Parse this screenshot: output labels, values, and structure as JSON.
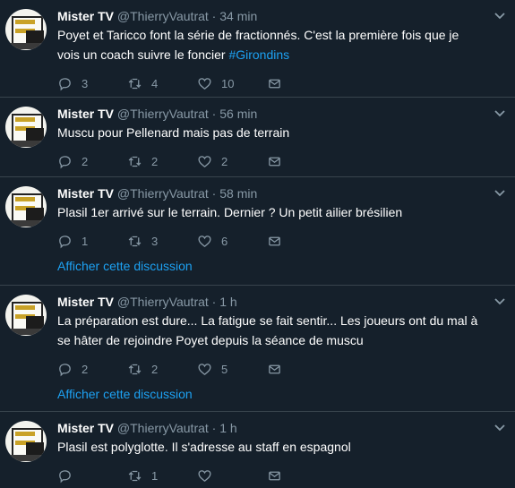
{
  "tweets": [
    {
      "name": "Mister TV",
      "handle": "@ThierryVautrat",
      "dot": "·",
      "time": "34 min",
      "text_before": "Poyet et Taricco font la série de fractionnés. C'est la première fois que je vois un coach suivre le  foncier ",
      "hashtag": "#Girondins",
      "replies": "3",
      "retweets": "4",
      "likes": "10",
      "thread_link": ""
    },
    {
      "name": "Mister TV",
      "handle": "@ThierryVautrat",
      "dot": "·",
      "time": "56 min",
      "text_before": "Muscu pour Pellenard mais pas de terrain",
      "hashtag": "",
      "replies": "2",
      "retweets": "2",
      "likes": "2",
      "thread_link": ""
    },
    {
      "name": "Mister TV",
      "handle": "@ThierryVautrat",
      "dot": "·",
      "time": "58 min",
      "text_before": "Plasil 1er arrivé sur le terrain. Dernier ? Un petit ailier brésilien",
      "hashtag": "",
      "replies": "1",
      "retweets": "3",
      "likes": "6",
      "thread_link": "Afficher cette discussion"
    },
    {
      "name": "Mister TV",
      "handle": "@ThierryVautrat",
      "dot": "·",
      "time": "1 h",
      "text_before": "La préparation est dure... La fatigue se fait sentir... Les joueurs ont du mal à se hâter de rejoindre Poyet depuis la séance de muscu",
      "hashtag": "",
      "replies": "2",
      "retweets": "2",
      "likes": "5",
      "thread_link": "Afficher cette discussion"
    },
    {
      "name": "Mister TV",
      "handle": "@ThierryVautrat",
      "dot": "·",
      "time": "1 h",
      "text_before": "Plasil est polyglotte. Il s'adresse au staff en espagnol",
      "hashtag": "",
      "replies": "",
      "retweets": "1",
      "likes": "",
      "thread_link": ""
    }
  ],
  "icons": {
    "reply": "reply-icon",
    "retweet": "retweet-icon",
    "like": "heart-icon",
    "message": "envelope-icon",
    "menu": "chevron-down-icon"
  },
  "colors": {
    "background": "#15202b",
    "divider": "#38444d",
    "muted": "#8899a6",
    "link": "#1da1f2"
  }
}
